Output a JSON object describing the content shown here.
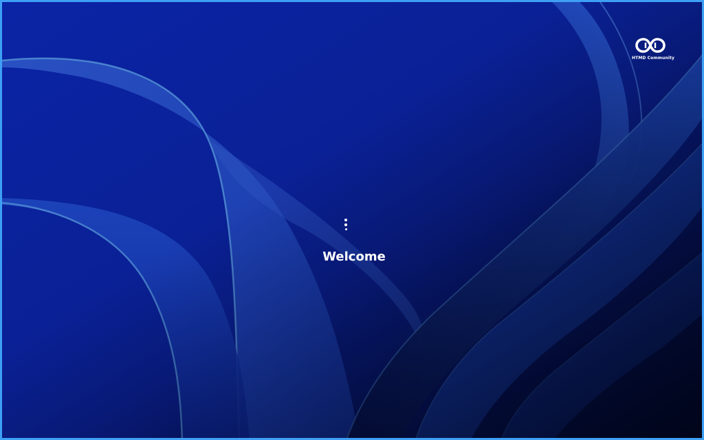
{
  "brand": {
    "logo_text": "HTMD Community",
    "logo_icon": "htmd-infinity-logo-icon"
  },
  "status": {
    "message": "Welcome",
    "spinner": "loading-dots-icon"
  },
  "colors": {
    "background": "#0a1f8f",
    "frame_border": "#3ea0f5",
    "text": "#ffffff"
  }
}
